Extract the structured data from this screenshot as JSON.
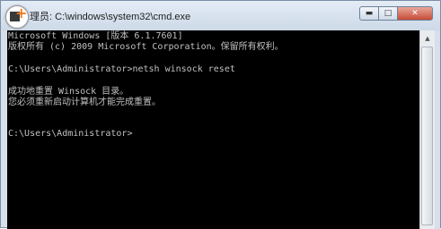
{
  "window": {
    "title": "C:\\windows\\system32\\cmd.exe",
    "title_prefix": "理员:",
    "buttons": {
      "minimize": "▬",
      "maximize": "□",
      "close": "✕"
    }
  },
  "console": {
    "lines": [
      "Microsoft Windows [版本 6.1.7601]",
      "版权所有 (c) 2009 Microsoft Corporation。保留所有权利。",
      "C:\\Users\\Administrator>netsh winsock reset",
      "成功地重置 Winsock 目录。",
      "您必须重新启动计算机才能完成重置。",
      "C:\\Users\\Administrator>"
    ]
  },
  "scrollbar": {
    "up_arrow": "▲"
  },
  "colors": {
    "console_bg": "#000000",
    "console_text": "#c0c0c0",
    "close_button": "#c74b36"
  },
  "icons": {
    "overlay": "add-plus-icon"
  }
}
